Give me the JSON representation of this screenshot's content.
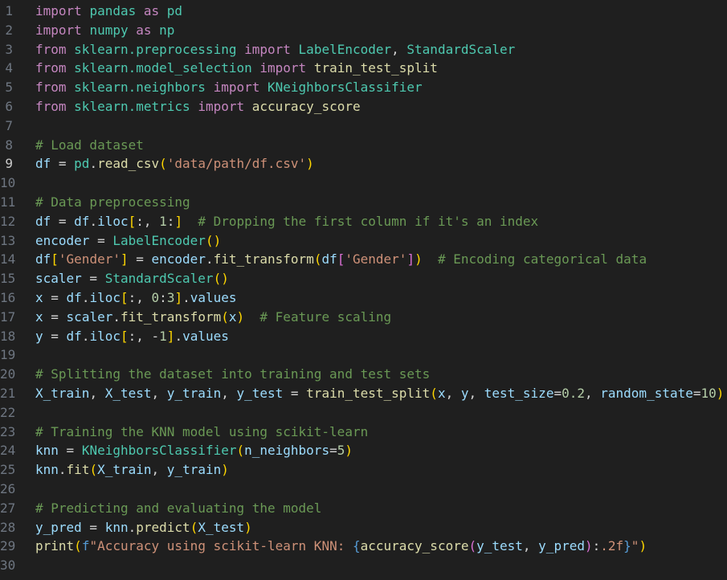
{
  "editor": {
    "active_line": 9,
    "lines": [
      {
        "no": "1",
        "tokens": [
          [
            "kw",
            "import"
          ],
          [
            "op",
            " "
          ],
          [
            "md",
            "pandas"
          ],
          [
            "op",
            " "
          ],
          [
            "kw",
            "as"
          ],
          [
            "op",
            " "
          ],
          [
            "md",
            "pd"
          ]
        ]
      },
      {
        "no": "2",
        "tokens": [
          [
            "kw",
            "import"
          ],
          [
            "op",
            " "
          ],
          [
            "md",
            "numpy"
          ],
          [
            "op",
            " "
          ],
          [
            "kw",
            "as"
          ],
          [
            "op",
            " "
          ],
          [
            "md",
            "np"
          ]
        ]
      },
      {
        "no": "3",
        "tokens": [
          [
            "kw",
            "from"
          ],
          [
            "op",
            " "
          ],
          [
            "md",
            "sklearn.preprocessing"
          ],
          [
            "op",
            " "
          ],
          [
            "kw",
            "import"
          ],
          [
            "op",
            " "
          ],
          [
            "cls",
            "LabelEncoder"
          ],
          [
            "op",
            ", "
          ],
          [
            "cls",
            "StandardScaler"
          ]
        ]
      },
      {
        "no": "4",
        "tokens": [
          [
            "kw",
            "from"
          ],
          [
            "op",
            " "
          ],
          [
            "md",
            "sklearn.model_selection"
          ],
          [
            "op",
            " "
          ],
          [
            "kw",
            "import"
          ],
          [
            "op",
            " "
          ],
          [
            "fn",
            "train_test_split"
          ]
        ]
      },
      {
        "no": "5",
        "tokens": [
          [
            "kw",
            "from"
          ],
          [
            "op",
            " "
          ],
          [
            "md",
            "sklearn.neighbors"
          ],
          [
            "op",
            " "
          ],
          [
            "kw",
            "import"
          ],
          [
            "op",
            " "
          ],
          [
            "cls",
            "KNeighborsClassifier"
          ]
        ]
      },
      {
        "no": "6",
        "tokens": [
          [
            "kw",
            "from"
          ],
          [
            "op",
            " "
          ],
          [
            "md",
            "sklearn.metrics"
          ],
          [
            "op",
            " "
          ],
          [
            "kw",
            "import"
          ],
          [
            "op",
            " "
          ],
          [
            "fn",
            "accuracy_score"
          ]
        ]
      },
      {
        "no": "7",
        "tokens": []
      },
      {
        "no": "8",
        "tokens": [
          [
            "cm",
            "# Load dataset"
          ]
        ]
      },
      {
        "no": "9",
        "tokens": [
          [
            "v",
            "df"
          ],
          [
            "op",
            " = "
          ],
          [
            "md",
            "pd"
          ],
          [
            "op",
            "."
          ],
          [
            "fn",
            "read_csv"
          ],
          [
            "br1",
            "("
          ],
          [
            "str",
            "'data/path/df.csv'"
          ],
          [
            "br1",
            ")"
          ]
        ]
      },
      {
        "no": "10",
        "tokens": []
      },
      {
        "no": "11",
        "tokens": [
          [
            "cm",
            "# Data preprocessing"
          ]
        ]
      },
      {
        "no": "12",
        "tokens": [
          [
            "v",
            "df"
          ],
          [
            "op",
            " = "
          ],
          [
            "v",
            "df"
          ],
          [
            "op",
            "."
          ],
          [
            "v",
            "iloc"
          ],
          [
            "br1",
            "["
          ],
          [
            "op",
            ":, "
          ],
          [
            "num",
            "1"
          ],
          [
            "op",
            ":"
          ],
          [
            "br1",
            "]"
          ],
          [
            "op",
            "  "
          ],
          [
            "cm",
            "# Dropping the first column if it's an index"
          ]
        ]
      },
      {
        "no": "13",
        "tokens": [
          [
            "v",
            "encoder"
          ],
          [
            "op",
            " = "
          ],
          [
            "cls",
            "LabelEncoder"
          ],
          [
            "br1",
            "()"
          ]
        ]
      },
      {
        "no": "14",
        "tokens": [
          [
            "v",
            "df"
          ],
          [
            "br1",
            "["
          ],
          [
            "str",
            "'Gender'"
          ],
          [
            "br1",
            "]"
          ],
          [
            "op",
            " = "
          ],
          [
            "v",
            "encoder"
          ],
          [
            "op",
            "."
          ],
          [
            "fn",
            "fit_transform"
          ],
          [
            "br1",
            "("
          ],
          [
            "v",
            "df"
          ],
          [
            "br2",
            "["
          ],
          [
            "str",
            "'Gender'"
          ],
          [
            "br2",
            "]"
          ],
          [
            "br1",
            ")"
          ],
          [
            "op",
            "  "
          ],
          [
            "cm",
            "# Encoding categorical data"
          ]
        ]
      },
      {
        "no": "15",
        "tokens": [
          [
            "v",
            "scaler"
          ],
          [
            "op",
            " = "
          ],
          [
            "cls",
            "StandardScaler"
          ],
          [
            "br1",
            "()"
          ]
        ]
      },
      {
        "no": "16",
        "tokens": [
          [
            "v",
            "x"
          ],
          [
            "op",
            " = "
          ],
          [
            "v",
            "df"
          ],
          [
            "op",
            "."
          ],
          [
            "v",
            "iloc"
          ],
          [
            "br1",
            "["
          ],
          [
            "op",
            ":, "
          ],
          [
            "num",
            "0"
          ],
          [
            "op",
            ":"
          ],
          [
            "num",
            "3"
          ],
          [
            "br1",
            "]"
          ],
          [
            "op",
            "."
          ],
          [
            "v",
            "values"
          ]
        ]
      },
      {
        "no": "17",
        "tokens": [
          [
            "v",
            "x"
          ],
          [
            "op",
            " = "
          ],
          [
            "v",
            "scaler"
          ],
          [
            "op",
            "."
          ],
          [
            "fn",
            "fit_transform"
          ],
          [
            "br1",
            "("
          ],
          [
            "v",
            "x"
          ],
          [
            "br1",
            ")"
          ],
          [
            "op",
            "  "
          ],
          [
            "cm",
            "# Feature scaling"
          ]
        ]
      },
      {
        "no": "18",
        "tokens": [
          [
            "v",
            "y"
          ],
          [
            "op",
            " = "
          ],
          [
            "v",
            "df"
          ],
          [
            "op",
            "."
          ],
          [
            "v",
            "iloc"
          ],
          [
            "br1",
            "["
          ],
          [
            "op",
            ":, -"
          ],
          [
            "num",
            "1"
          ],
          [
            "br1",
            "]"
          ],
          [
            "op",
            "."
          ],
          [
            "v",
            "values"
          ]
        ]
      },
      {
        "no": "19",
        "tokens": []
      },
      {
        "no": "20",
        "tokens": [
          [
            "cm",
            "# Splitting the dataset into training and test sets"
          ]
        ]
      },
      {
        "no": "21",
        "tokens": [
          [
            "v",
            "X_train"
          ],
          [
            "op",
            ", "
          ],
          [
            "v",
            "X_test"
          ],
          [
            "op",
            ", "
          ],
          [
            "v",
            "y_train"
          ],
          [
            "op",
            ", "
          ],
          [
            "v",
            "y_test"
          ],
          [
            "op",
            " = "
          ],
          [
            "fn",
            "train_test_split"
          ],
          [
            "br1",
            "("
          ],
          [
            "v",
            "x"
          ],
          [
            "op",
            ", "
          ],
          [
            "v",
            "y"
          ],
          [
            "op",
            ", "
          ],
          [
            "v",
            "test_size"
          ],
          [
            "op",
            "="
          ],
          [
            "num",
            "0.2"
          ],
          [
            "op",
            ", "
          ],
          [
            "v",
            "random_state"
          ],
          [
            "op",
            "="
          ],
          [
            "num",
            "10"
          ],
          [
            "br1",
            ")"
          ]
        ]
      },
      {
        "no": "22",
        "tokens": []
      },
      {
        "no": "23",
        "tokens": [
          [
            "cm",
            "# Training the KNN model using scikit-learn"
          ]
        ]
      },
      {
        "no": "24",
        "tokens": [
          [
            "v",
            "knn"
          ],
          [
            "op",
            " = "
          ],
          [
            "cls",
            "KNeighborsClassifier"
          ],
          [
            "br1",
            "("
          ],
          [
            "v",
            "n_neighbors"
          ],
          [
            "op",
            "="
          ],
          [
            "num",
            "5"
          ],
          [
            "br1",
            ")"
          ]
        ]
      },
      {
        "no": "25",
        "tokens": [
          [
            "v",
            "knn"
          ],
          [
            "op",
            "."
          ],
          [
            "fn",
            "fit"
          ],
          [
            "br1",
            "("
          ],
          [
            "v",
            "X_train"
          ],
          [
            "op",
            ", "
          ],
          [
            "v",
            "y_train"
          ],
          [
            "br1",
            ")"
          ]
        ]
      },
      {
        "no": "26",
        "tokens": []
      },
      {
        "no": "27",
        "tokens": [
          [
            "cm",
            "# Predicting and evaluating the model"
          ]
        ]
      },
      {
        "no": "28",
        "tokens": [
          [
            "v",
            "y_pred"
          ],
          [
            "op",
            " = "
          ],
          [
            "v",
            "knn"
          ],
          [
            "op",
            "."
          ],
          [
            "fn",
            "predict"
          ],
          [
            "br1",
            "("
          ],
          [
            "v",
            "X_test"
          ],
          [
            "br1",
            ")"
          ]
        ]
      },
      {
        "no": "29",
        "tokens": [
          [
            "fn",
            "print"
          ],
          [
            "br1",
            "("
          ],
          [
            "sfx",
            "f"
          ],
          [
            "str",
            "\"Accuracy using scikit-learn KNN: "
          ],
          [
            "esc",
            "{"
          ],
          [
            "fn",
            "accuracy_score"
          ],
          [
            "br2",
            "("
          ],
          [
            "v",
            "y_test"
          ],
          [
            "op",
            ", "
          ],
          [
            "v",
            "y_pred"
          ],
          [
            "br2",
            ")"
          ],
          [
            "op",
            ":"
          ],
          [
            "str",
            ".2f"
          ],
          [
            "esc",
            "}"
          ],
          [
            "str",
            "\""
          ],
          [
            "br1",
            ")"
          ]
        ]
      },
      {
        "no": "30",
        "tokens": []
      }
    ]
  }
}
